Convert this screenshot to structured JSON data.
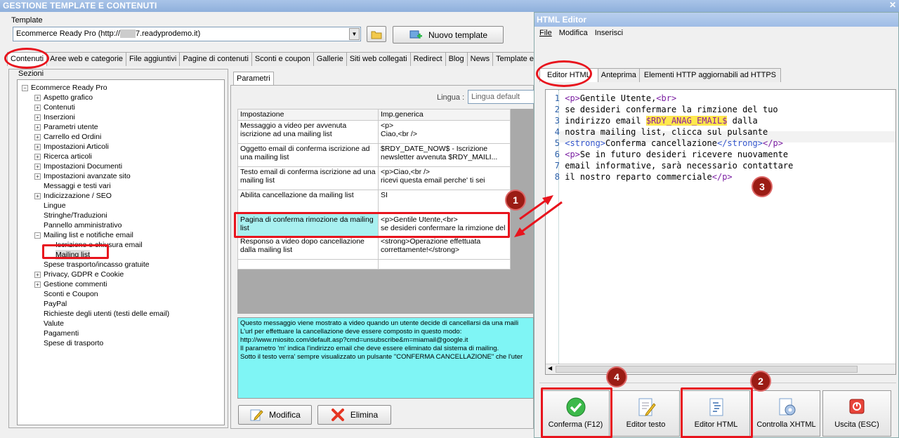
{
  "window": {
    "title": "GESTIONE TEMPLATE E CONTENUTI"
  },
  "template": {
    "label": "Template",
    "value": "Ecommerce Ready Pro (http://",
    "value_suffix": "7.readyprodemo.it)",
    "new_button": "Nuovo template"
  },
  "tabs": [
    "Contenuti",
    "Aree web e categorie",
    "File aggiuntivi",
    "Pagine di contenuti",
    "Sconti e coupon",
    "Gallerie",
    "Siti web collegati",
    "Redirect",
    "Blog",
    "News",
    "Template e"
  ],
  "sections": {
    "label": "Sezioni",
    "root": "Ecommerce Ready Pro",
    "items": [
      "Aspetto grafico",
      "Contenuti",
      "Inserzioni",
      "Parametri utente",
      "Carrello ed Ordini",
      "Impostazioni Articoli",
      "Ricerca articoli",
      "Impostazioni Documenti",
      "Impostazioni avanzate sito",
      "Messaggi e testi vari",
      "Indicizzazione / SEO",
      "Lingue",
      "Stringhe/Traduzioni",
      "Pannello amministrativo",
      "Mailing list e notifiche email",
      "Iscrizione e chiusura email",
      "Mailing list",
      "Spese trasporto/incasso gratuite",
      "Privacy, GDPR e Cookie",
      "Gestione commenti",
      "Sconti e Coupon",
      "PayPal",
      "Richieste degli utenti (testi delle email)",
      "Valute",
      "Pagamenti",
      "Spese di trasporto"
    ]
  },
  "params": {
    "tab": "Parametri",
    "lingua_label": "Lingua :",
    "lingua_value": "Lingua default",
    "col1": "Impostazione",
    "col2": "Imp.generica",
    "rows": [
      {
        "a": "Messaggio a video per avvenuta iscrizione ad una mailing list",
        "b": "<p>\n Ciao,<br />"
      },
      {
        "a": "Oggetto email di conferma iscrizione ad una mailing list",
        "b": "$RDY_DATE_NOW$ - Iscrizione newsletter avvenuta $RDY_MAILI..."
      },
      {
        "a": "Testo email di conferma iscrizione ad una mailing list",
        "b": "<p>Ciao,<br />\nricevi questa email perche' ti sei"
      },
      {
        "a": "Abilita cancellazione da mailing list",
        "b": "SI"
      },
      {
        "a": "Pagina di conferma rimozione da mailing list",
        "b": "<p>Gentile Utente,<br>\nse desideri confermare la rimzione del"
      },
      {
        "a": "Responso a video dopo cancellazione dalla mailing list",
        "b": "<strong>Operazione effettuata correttamente!</strong>"
      }
    ],
    "help_lines": [
      "Questo messaggio viene mostrato a video quando un utente decide di cancellarsi da una maili",
      "L'url per effettuare la cancellazione deve essere composto in questo modo:",
      "http://www.miosito.com/default.asp?cmd=unsubscribe&m=miamail@google.it",
      "Il parametro 'm' indica l'indirizzo email che deve essere eliminato dal sistema di mailing.",
      "Sotto il testo verra' sempre visualizzato un pulsante \"CONFERMA CANCELLAZIONE\" che l'uter"
    ],
    "modifica": "Modifica",
    "elimina": "Elimina"
  },
  "editor": {
    "title": "HTML Editor",
    "menu": [
      "File",
      "Modifica",
      "Inserisci"
    ],
    "tabs": [
      "Editor HTML",
      "Anteprima",
      "Elementi HTTP aggiornabili ad HTTPS"
    ],
    "buttons": [
      "Conferma (F12)",
      "Editor testo",
      "Editor HTML",
      "Controlla XHTML",
      "Uscita (ESC)"
    ]
  },
  "badges": [
    "1",
    "2",
    "3",
    "4"
  ],
  "colors": {
    "accent_red": "#e8141d",
    "badge": "#9b1c14",
    "help_bg": "#7ff5f5",
    "row_highlight": "#a8f0f0"
  }
}
